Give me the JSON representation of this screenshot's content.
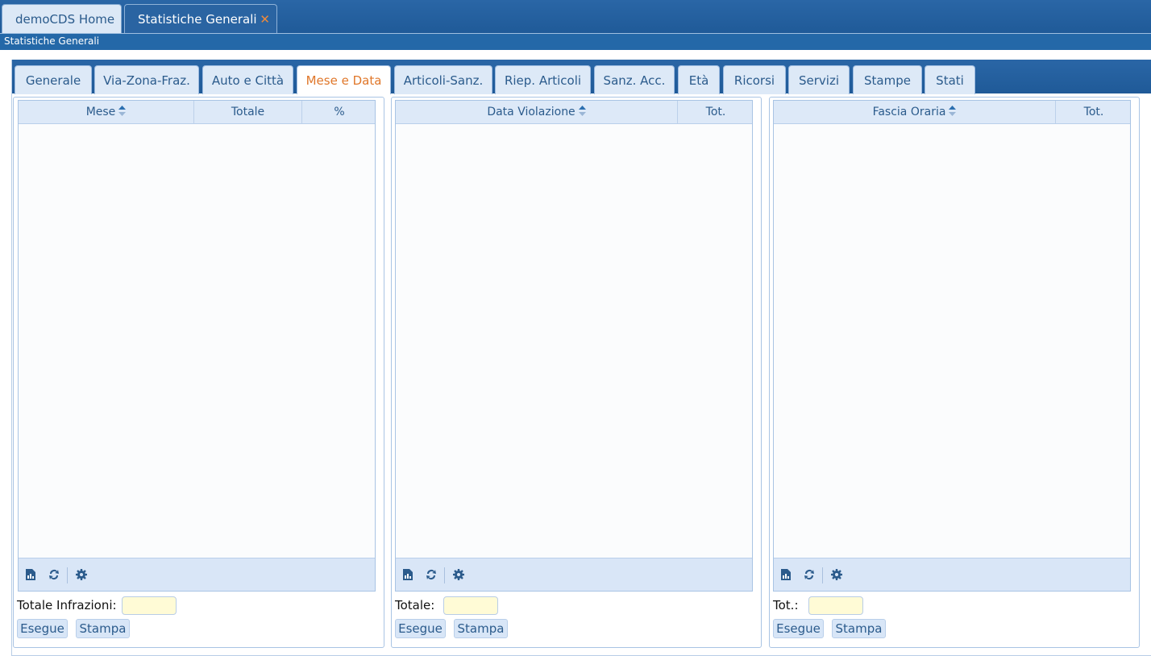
{
  "app_tabs": [
    {
      "label": "demoCDS Home"
    },
    {
      "label": "Statistiche Generali",
      "close": "✕"
    }
  ],
  "subtitle": "Statistiche Generali",
  "section_tabs": [
    {
      "label": "Generale"
    },
    {
      "label": "Via-Zona-Fraz."
    },
    {
      "label": "Auto e Città"
    },
    {
      "label": "Mese e Data",
      "active": true
    },
    {
      "label": "Articoli-Sanz."
    },
    {
      "label": "Riep. Articoli"
    },
    {
      "label": "Sanz. Acc."
    },
    {
      "label": "Età"
    },
    {
      "label": "Ricorsi"
    },
    {
      "label": "Servizi"
    },
    {
      "label": "Stampe"
    },
    {
      "label": "Stati"
    }
  ],
  "panels": [
    {
      "columns": [
        "Mese",
        "Totale",
        "%"
      ],
      "total_label": "Totale Infrazioni:",
      "total_value": "",
      "run_label": "Esegue",
      "print_label": "Stampa"
    },
    {
      "columns": [
        "Data Violazione",
        "Tot."
      ],
      "total_label": "Totale:",
      "total_value": "",
      "run_label": "Esegue",
      "print_label": "Stampa"
    },
    {
      "columns": [
        "Fascia Oraria",
        "Tot."
      ],
      "total_label": "Tot.:",
      "total_value": "",
      "run_label": "Esegue",
      "print_label": "Stampa"
    }
  ],
  "footer_icons": [
    "export-chart-icon",
    "refresh-icon",
    "settings-icon"
  ],
  "colors": {
    "header_blue": "#2468a8",
    "tab_bg": "#dde9f7",
    "active_tab_text": "#e0772a",
    "input_bg": "#fffbd6"
  }
}
